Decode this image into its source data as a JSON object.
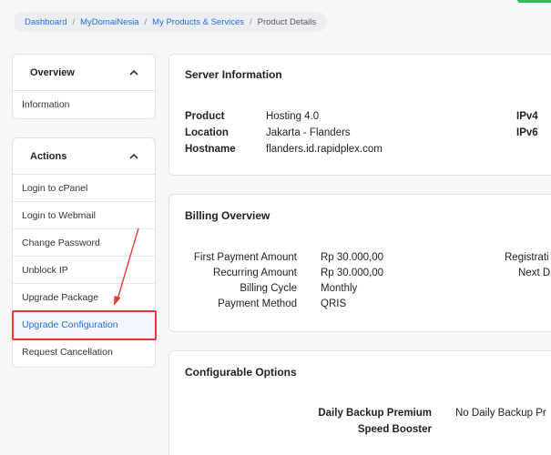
{
  "breadcrumb": {
    "items": [
      "Dashboard",
      "MyDomaiNesia",
      "My Products & Services"
    ],
    "current": "Product Details",
    "separator": "/"
  },
  "sidebar": {
    "overview": {
      "title": "Overview",
      "items": [
        "Information"
      ]
    },
    "actions": {
      "title": "Actions",
      "items": [
        "Login to cPanel",
        "Login to Webmail",
        "Change Password",
        "Unblock IP",
        "Upgrade Package",
        "Upgrade Configuration",
        "Request Cancellation"
      ],
      "active": "Upgrade Configuration"
    }
  },
  "server": {
    "title": "Server Information",
    "product_label": "Product",
    "product_value": "Hosting 4.0",
    "location_label": "Location",
    "location_value": "Jakarta - Flanders",
    "hostname_label": "Hostname",
    "hostname_value": "flanders.id.rapidplex.com",
    "ipv4_label": "IPv4",
    "ipv6_label": "IPv6"
  },
  "billing": {
    "title": "Billing Overview",
    "first_payment_label": "First Payment Amount",
    "first_payment_value": "Rp 30.000,00",
    "recurring_label": "Recurring Amount",
    "recurring_value": "Rp 30.000,00",
    "cycle_label": "Billing Cycle",
    "cycle_value": "Monthly",
    "method_label": "Payment Method",
    "method_value": "QRIS",
    "registration_label": "Registrati",
    "next_due_label": "Next D"
  },
  "config": {
    "title": "Configurable Options",
    "backup_label": "Daily Backup Premium",
    "backup_value": "No Daily Backup Pr",
    "speed_label": "Speed Booster"
  },
  "colors": {
    "link": "#1e6fd9",
    "highlight": "#e53935",
    "accent_green": "#2ebd59"
  }
}
